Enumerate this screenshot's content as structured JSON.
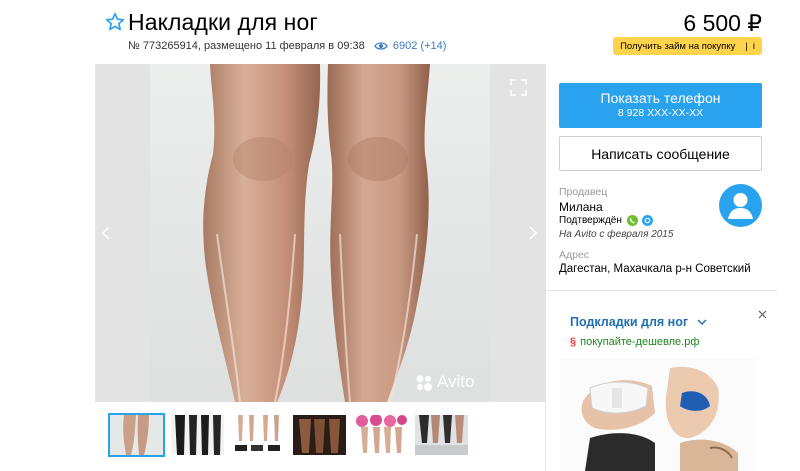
{
  "listing": {
    "title": "Накладки для ног",
    "meta": "№ 773265914, размещено 11 февраля в 09:38",
    "views": "6902 (+14)",
    "price": "6 500 ₽"
  },
  "loan": {
    "label": "Получить займ на покупку",
    "sep": "|",
    "info": "i"
  },
  "gallery": {
    "watermark": "Avito",
    "thumb_count": 6
  },
  "contact": {
    "show_phone": "Показать телефон",
    "phone_masked": "8 928 XXX-XX-XX",
    "write_message": "Написать сообщение"
  },
  "seller": {
    "label": "Продавец",
    "name": "Милана",
    "verified": "Подтверждён",
    "since": "На Avito с февраля 2015",
    "address_label": "Адрес",
    "address": "Дагестан, Махачкала р-н Советский"
  },
  "ad": {
    "title": "Подкладки для ног",
    "source_icon": "§",
    "source": "покупайте-дешевле.рф"
  },
  "colors": {
    "accent_blue": "#2aa3ee",
    "link_blue": "#1f6fb5",
    "loan_yellow": "#ffd34a",
    "ad_green": "#1c8a1c"
  }
}
